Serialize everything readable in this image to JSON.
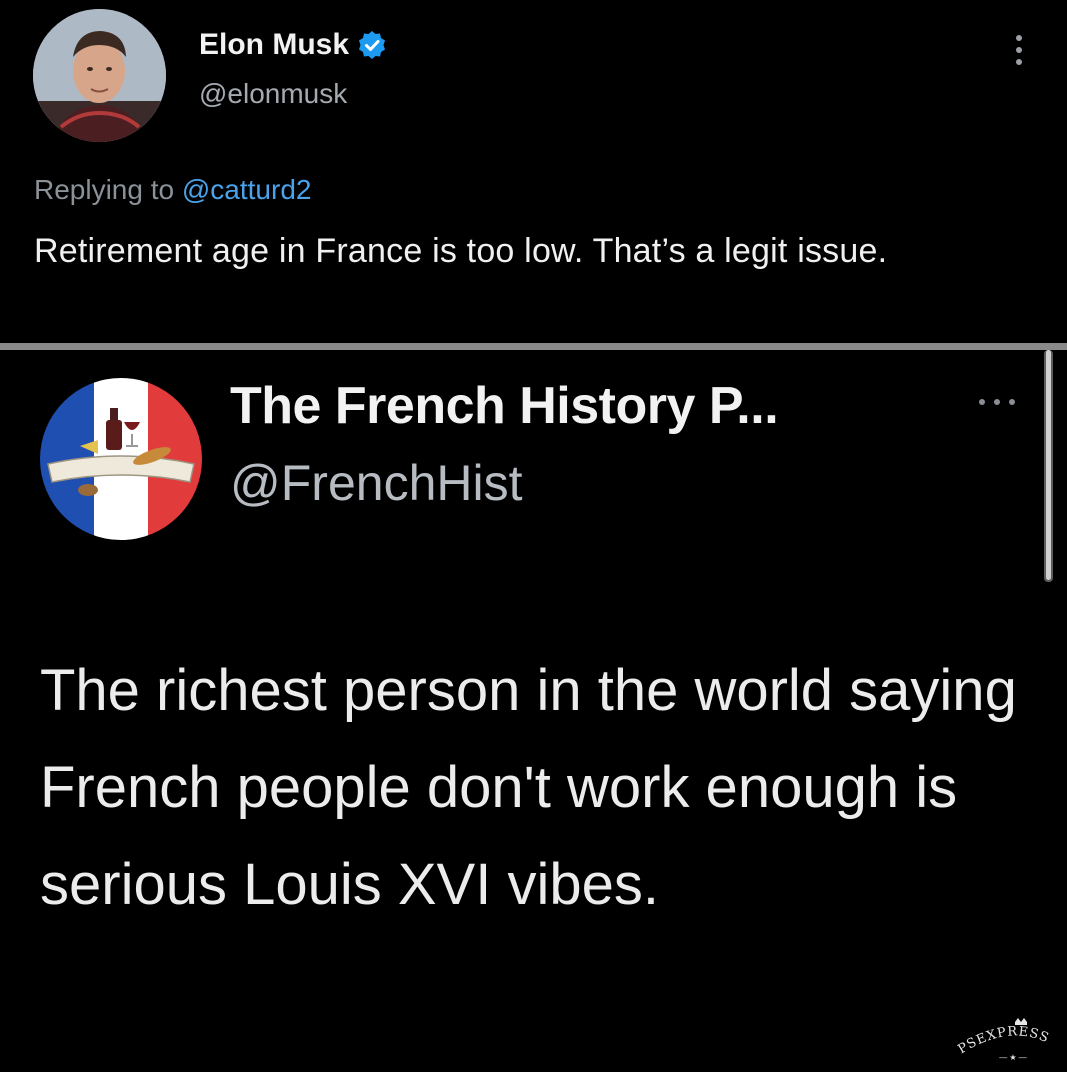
{
  "tweet1": {
    "author_name": "Elon Musk",
    "author_handle": "@elonmusk",
    "verified": true,
    "replying_prefix": "Replying to",
    "replying_to": "@catturd2",
    "text": "Retirement age in France is too low. That’s a legit issue."
  },
  "tweet2": {
    "author_name": "The French History P...",
    "author_handle": "@FrenchHist",
    "text": "The richest person in the world saying French people don't work enough is serious Louis XVI vibes."
  },
  "watermark": {
    "text": "PSEXPRESS"
  },
  "colors": {
    "background": "#000000",
    "mention": "#4aa3ea",
    "verified": "#1d9bf0",
    "flag_blue": "#1f4fb0",
    "flag_red": "#e23b3b"
  },
  "icons": [
    "verified-badge-icon",
    "more-vertical-icon",
    "more-horizontal-icon"
  ]
}
